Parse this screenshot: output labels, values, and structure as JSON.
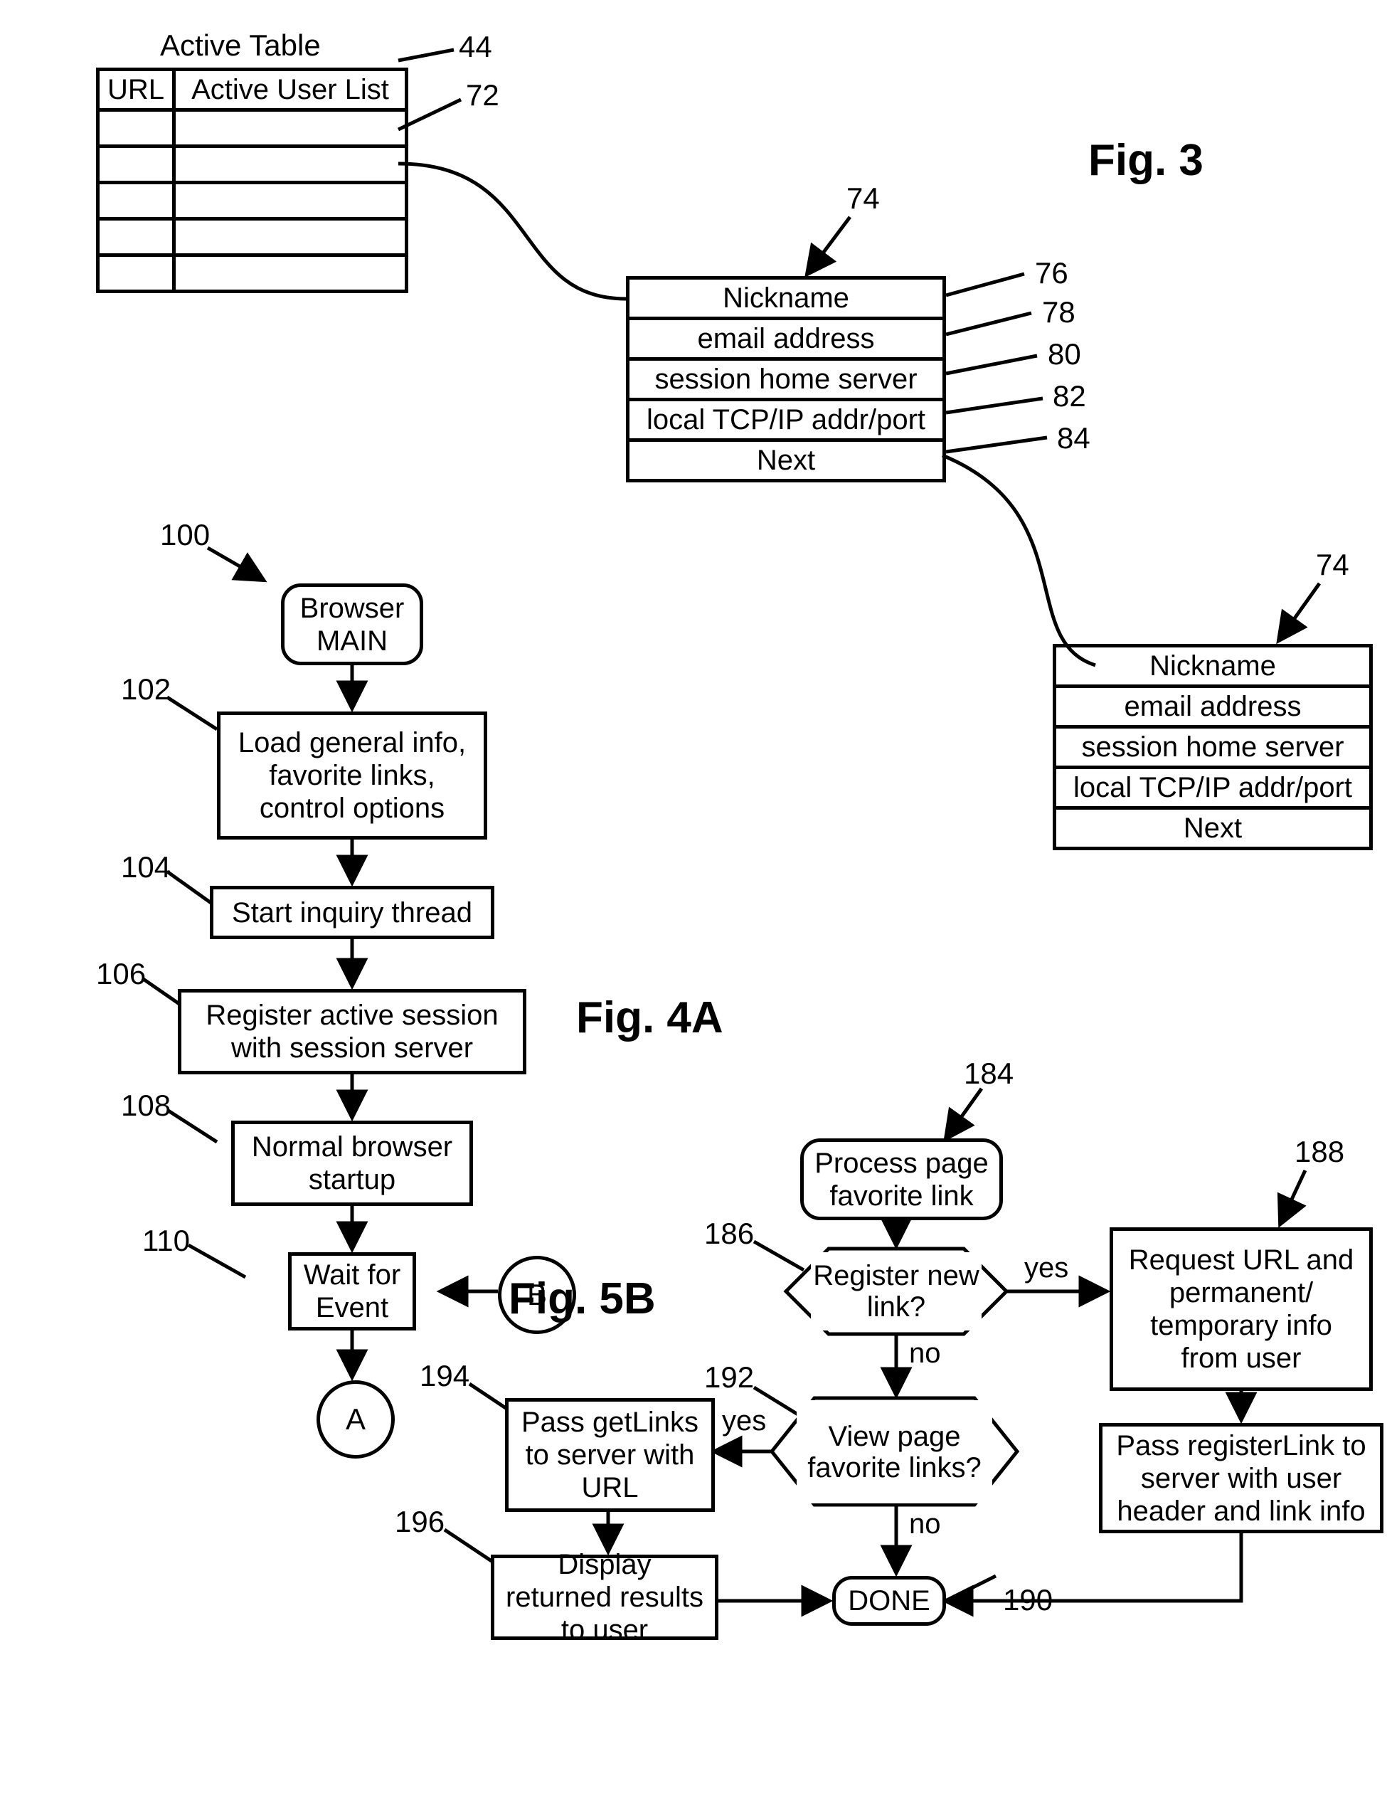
{
  "fig3": {
    "label": "Fig. 3",
    "table_title": "Active Table",
    "col_url": "URL",
    "col_user": "Active User List",
    "ref44": "44",
    "ref72": "72",
    "ref74a": "74",
    "ref74b": "74",
    "ref76": "76",
    "ref78": "78",
    "ref80": "80",
    "ref82": "82",
    "ref84": "84",
    "rec": {
      "nickname": "Nickname",
      "email": "email address",
      "server": "session home server",
      "addr": "local TCP/IP addr/port",
      "next": "Next"
    }
  },
  "fig4a": {
    "label": "Fig. 4A",
    "ref100": "100",
    "ref102": "102",
    "ref104": "104",
    "ref106": "106",
    "ref108": "108",
    "ref110": "110",
    "step100": "Browser MAIN",
    "step102": "Load general info, favorite links, control options",
    "step104": "Start inquiry thread",
    "step106": "Register active session with session server",
    "step108": "Normal browser startup",
    "step110": "Wait for Event",
    "connA": "A",
    "connB": "B"
  },
  "fig5b": {
    "label": "Fig. 5B",
    "ref184": "184",
    "ref186": "186",
    "ref188": "188",
    "ref190": "190",
    "ref192": "192",
    "ref194": "194",
    "ref196": "196",
    "step184": "Process page favorite link",
    "dec186": "Register new link?",
    "step188": "Request URL and permanent/ temporary info from user",
    "step190": "Pass registerLink to server with user header and link info",
    "dec192": "View page favorite links?",
    "step194": "Pass getLinks to server with URL",
    "step196": "Display returned results to user",
    "done": "DONE",
    "yes": "yes",
    "no": "no"
  }
}
